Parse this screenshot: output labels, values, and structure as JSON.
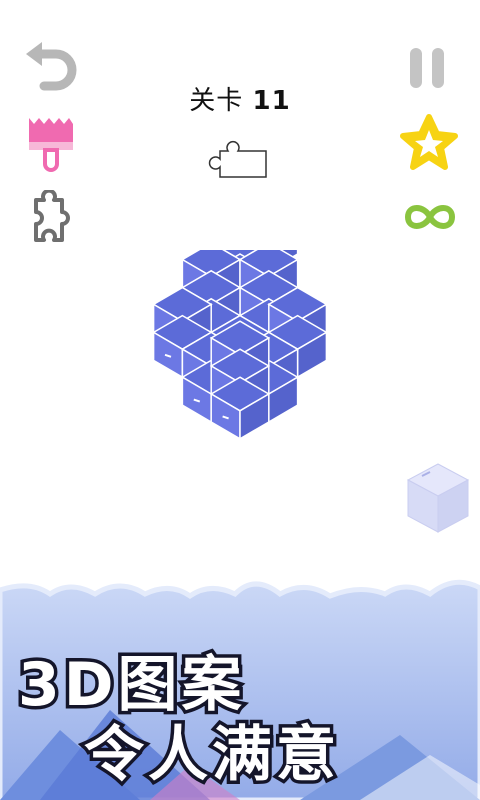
{
  "level": {
    "prefix": "关卡",
    "number": "11"
  },
  "toolbar": {
    "undo_icon": "undo-arrow-icon",
    "pause_icon": "pause-icon",
    "brush_icon": "paint-brush-icon",
    "star_icon": "star-icon",
    "puzzle_icon": "puzzle-piece-icon",
    "infinity_icon": "infinity-icon"
  },
  "colors": {
    "icon_gray": "#b7b7b7",
    "brush_pink": "#f06ab0",
    "star_yellow": "#f7d313",
    "infinity_green": "#8ac43f",
    "cube_top": "#5c6bd8",
    "cube_left": "#6c78e4",
    "cube_right": "#5563cc",
    "banner_sky": "#a9c0ef"
  },
  "banner": {
    "line1": "3D图案",
    "line2": "令人满意"
  }
}
